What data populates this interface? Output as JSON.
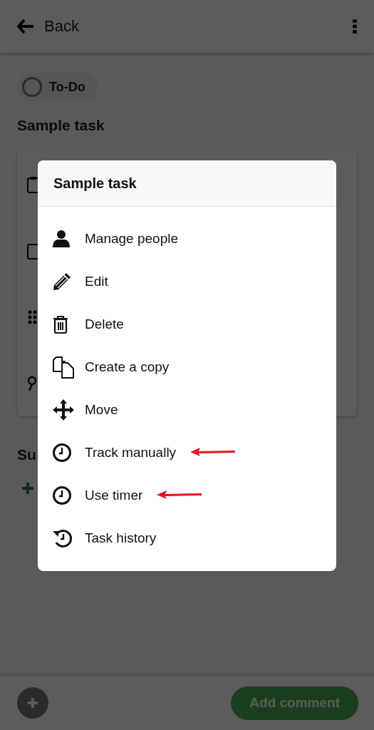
{
  "header": {
    "back_label": "Back"
  },
  "status_chip": {
    "label": "To-Do",
    "checked": false
  },
  "task_title": "Sample task",
  "subtasks_heading": "Su",
  "bottom_bar": {
    "comment_button": "Add comment"
  },
  "dialog": {
    "title": "Sample task",
    "items": [
      {
        "label": "Manage people",
        "kind": "person",
        "annotated": false
      },
      {
        "label": "Edit",
        "kind": "pencil",
        "annotated": false
      },
      {
        "label": "Delete",
        "kind": "trash",
        "annotated": false
      },
      {
        "label": "Create a copy",
        "kind": "copy",
        "annotated": false
      },
      {
        "label": "Move",
        "kind": "move",
        "annotated": false
      },
      {
        "label": "Track manually",
        "kind": "clock",
        "annotated": true
      },
      {
        "label": "Use timer",
        "kind": "clock",
        "annotated": true
      },
      {
        "label": "Task history",
        "kind": "history",
        "annotated": false
      }
    ]
  }
}
